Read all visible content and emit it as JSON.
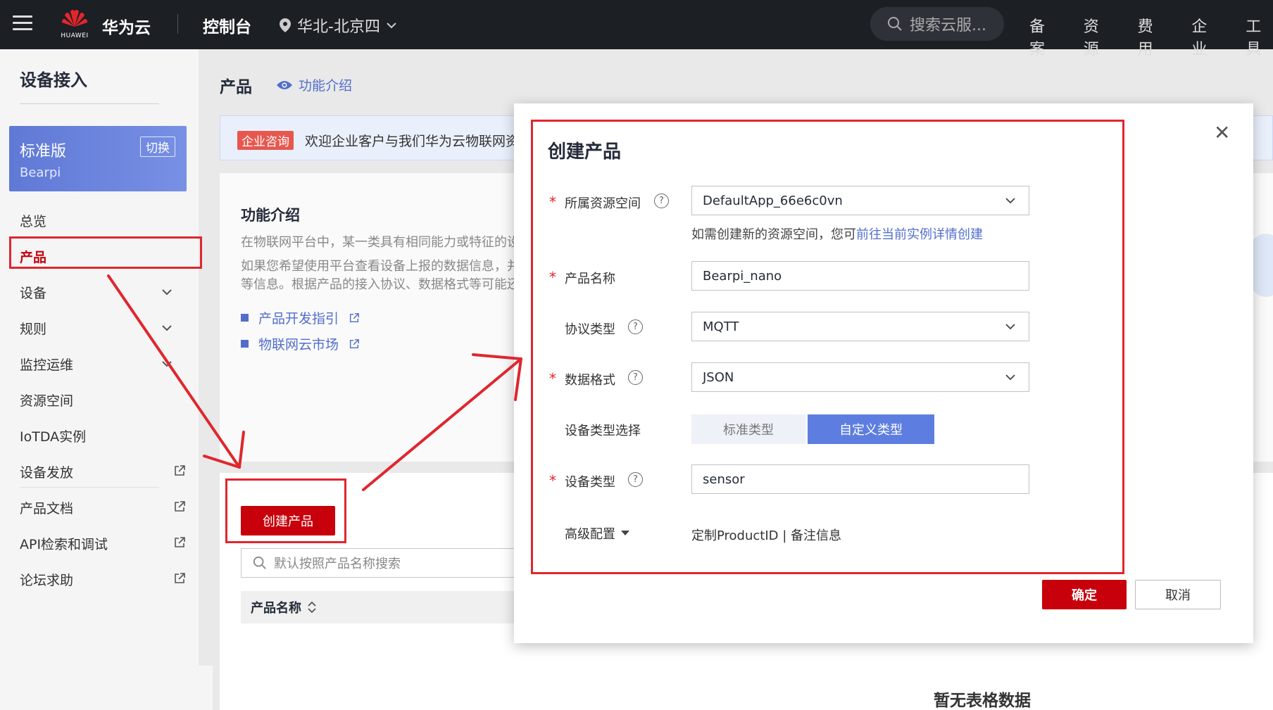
{
  "topbar": {
    "logo_text": "HUAWEI",
    "brand": "华为云",
    "console": "控制台",
    "region": "华北-北京四",
    "search_placeholder": "搜索云服...",
    "nav": [
      "备案",
      "资源",
      "费用",
      "企业",
      "工具"
    ]
  },
  "sidebar": {
    "title": "设备接入",
    "edition_name": "标准版",
    "edition_sub": "Bearpi",
    "switch_label": "切换",
    "items": [
      {
        "label": "总览"
      },
      {
        "label": "产品"
      },
      {
        "label": "设备"
      },
      {
        "label": "规则"
      },
      {
        "label": "监控运维"
      },
      {
        "label": "资源空间"
      },
      {
        "label": "IoTDA实例"
      },
      {
        "label": "设备发放"
      },
      {
        "label": "产品文档"
      },
      {
        "label": "API检索和调试"
      },
      {
        "label": "论坛求助"
      }
    ]
  },
  "main": {
    "page_title": "产品",
    "func_link": "功能介绍",
    "banner_tag": "企业咨询",
    "banner_text": "欢迎企业客户与我们华为云物联网资源",
    "intro_title": "功能介绍",
    "intro_p1": "在物联网平台中，某一类具有相同能力或特征的设",
    "intro_p2": "如果您希望使用平台查看设备上报的数据信息，并",
    "intro_p3": "等信息。根据产品的接入协议、数据格式等可能还",
    "link_dev_guide": "产品开发指引",
    "link_market": "物联网云市场",
    "create_button": "创建产品",
    "search_placeholder": "默认按照产品名称搜索",
    "col_product_name": "产品名称",
    "empty_text": "暂无表格数据"
  },
  "modal": {
    "title": "创建产品",
    "resource_space_label": "所属资源空间",
    "resource_space_value": "DefaultApp_66e6c0vn",
    "hint_prefix": "如需创建新的资源空间，您可",
    "hint_link": "前往当前实例详情创建",
    "product_name_label": "产品名称",
    "product_name_value": "Bearpi_nano",
    "protocol_label": "协议类型",
    "protocol_value": "MQTT",
    "data_format_label": "数据格式",
    "data_format_value": "JSON",
    "device_type_select_label": "设备类型选择",
    "type_standard": "标准类型",
    "type_custom": "自定义类型",
    "device_type_label": "设备类型",
    "device_type_value": "sensor",
    "advanced_label": "高级配置",
    "advanced_value": "定制ProductID | 备注信息",
    "ok_button": "确定",
    "cancel_button": "取消"
  },
  "colors": {
    "brand_red": "#c7000b",
    "accent_blue": "#526ecc",
    "annotation_red": "#e0262e"
  }
}
